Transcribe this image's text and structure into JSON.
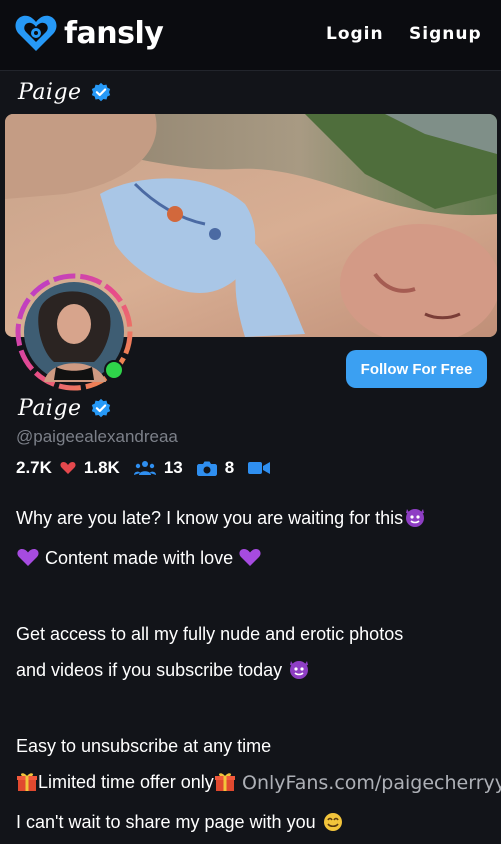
{
  "brand": {
    "name": "fansly",
    "color": "#2699f7"
  },
  "nav": {
    "login": "Login",
    "signup": "Signup"
  },
  "profile": {
    "display_name": "Paige",
    "handle": "@paigeealexandreaa",
    "verified_icon": "verified-badge-icon",
    "online": true,
    "follow_label": "Follow For Free"
  },
  "stats": {
    "followers": "2.7K",
    "likes": "1.8K",
    "subscribers": "13",
    "photos": "8"
  },
  "bio": {
    "line1": "Why are you late? I know you are waiting for this",
    "line2": "Content made with love",
    "line3": "Get access to all my fully nude and erotic photos",
    "line4": "and videos if you subscribe today",
    "line5": "Easy to unsubscribe at any time",
    "line6": "Limited time offer only",
    "line7": "I can't wait to share my page with you"
  },
  "watermark": "OnlyFans.com/paigecherryy"
}
